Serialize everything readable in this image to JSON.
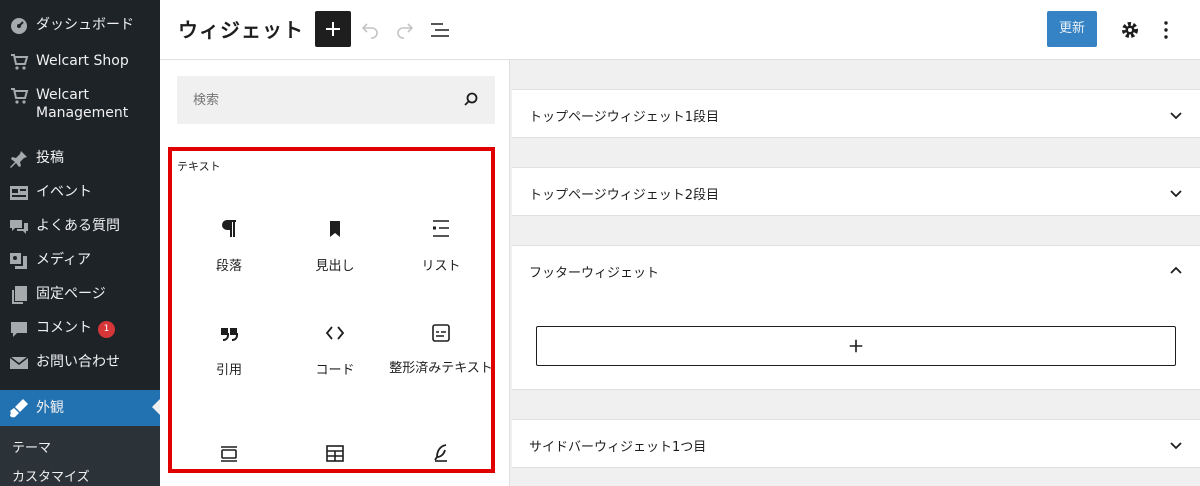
{
  "sidebar": {
    "items": [
      {
        "label": "ダッシュボード",
        "icon": "dashboard-icon"
      },
      {
        "label": "Welcart Shop",
        "icon": "cart-icon"
      },
      {
        "label": "Welcart Management",
        "icon": "cart-icon"
      },
      {
        "label": "投稿",
        "icon": "pin-icon"
      },
      {
        "label": "イベント",
        "icon": "event-icon"
      },
      {
        "label": "よくある質問",
        "icon": "comments-icon"
      },
      {
        "label": "メディア",
        "icon": "media-icon"
      },
      {
        "label": "固定ページ",
        "icon": "pages-icon"
      },
      {
        "label": "コメント",
        "icon": "comment-icon",
        "badge": "1"
      },
      {
        "label": "お問い合わせ",
        "icon": "mail-icon"
      },
      {
        "label": "外観",
        "icon": "appearance-icon"
      }
    ],
    "submenu": [
      "テーマ",
      "カスタマイズ"
    ]
  },
  "header": {
    "title": "ウィジェット",
    "update_label": "更新"
  },
  "inserter": {
    "search_placeholder": "検索",
    "category": "テキスト",
    "blocks": [
      {
        "label": "段落",
        "icon": "paragraph-icon"
      },
      {
        "label": "見出し",
        "icon": "heading-icon"
      },
      {
        "label": "リスト",
        "icon": "list-icon"
      },
      {
        "label": "引用",
        "icon": "quote-icon"
      },
      {
        "label": "コード",
        "icon": "code-icon"
      },
      {
        "label": "整形済みテキスト",
        "icon": "preformatted-icon"
      },
      {
        "label": "",
        "icon": "pullquote-icon"
      },
      {
        "label": "",
        "icon": "table-icon"
      },
      {
        "label": "",
        "icon": "verse-icon"
      }
    ]
  },
  "widget_areas": [
    {
      "title": "トップページウィジェット1段目",
      "expanded": false
    },
    {
      "title": "トップページウィジェット2段目",
      "expanded": false
    },
    {
      "title": "フッターウィジェット",
      "expanded": true
    },
    {
      "title": "サイドバーウィジェット1つ目",
      "expanded": false
    }
  ],
  "colors": {
    "sidebar_bg": "#1d2327",
    "active_bg": "#2271b1",
    "update_btn": "#3582c4",
    "highlight": "#e00000",
    "badge": "#d63638"
  }
}
